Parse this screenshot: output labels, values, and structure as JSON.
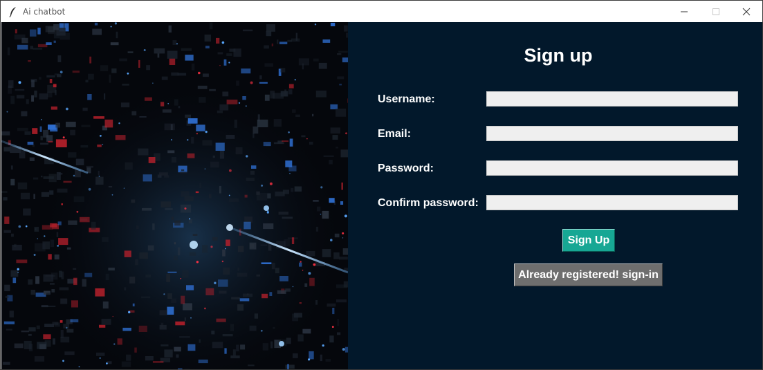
{
  "window": {
    "title": "Ai chatbot",
    "app_icon": "feather-icon",
    "controls": [
      "minimize-icon",
      "maximize-icon",
      "close-icon"
    ]
  },
  "hero": {
    "description_icon": "abstract-tech-city-image"
  },
  "form": {
    "heading": "Sign up",
    "fields": [
      {
        "label": "Username:",
        "value": ""
      },
      {
        "label": "Email:",
        "value": ""
      },
      {
        "label": "Password:",
        "value": ""
      },
      {
        "label": "Confirm password:",
        "value": ""
      }
    ],
    "signup_button": "Sign Up",
    "signin_button": "Already registered! sign-in"
  },
  "colors": {
    "panel_bg": "#02182b",
    "signup_button": "#17a794",
    "signin_button": "#6e6e6e",
    "field_bg": "#efefef"
  }
}
